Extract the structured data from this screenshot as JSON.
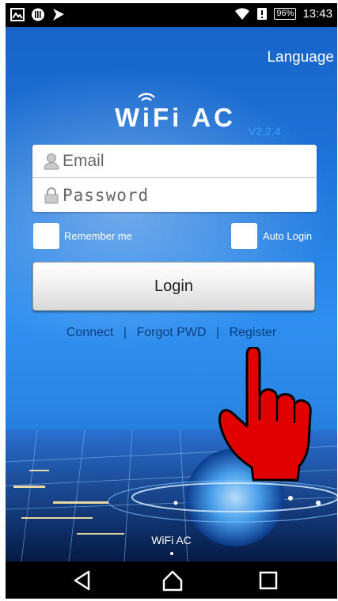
{
  "status_bar": {
    "left_icons": [
      "gallery-notification-icon",
      "voicemail-icon",
      "signal-flag-icon"
    ],
    "battery_percent": "96",
    "battery_unit": "%",
    "time": "13:43"
  },
  "header": {
    "language_label": "Language"
  },
  "branding": {
    "app_name": "WiFi AC",
    "version": "V2.2.4"
  },
  "login_form": {
    "email_placeholder": "Email",
    "password_placeholder": "Password",
    "remember_me_label": "Remember me",
    "auto_login_label": "Auto Login",
    "login_button_label": "Login"
  },
  "links": {
    "connect": "Connect",
    "separator": "|",
    "forgot_pwd": "Forgot PWD",
    "register": "Register"
  },
  "footer": {
    "title": "WiFi AC"
  },
  "colors": {
    "background_blue": "#1e73d8",
    "link_color": "#0d3f7e",
    "version_color": "#3aa0ff",
    "hand_red": "#e00000"
  }
}
